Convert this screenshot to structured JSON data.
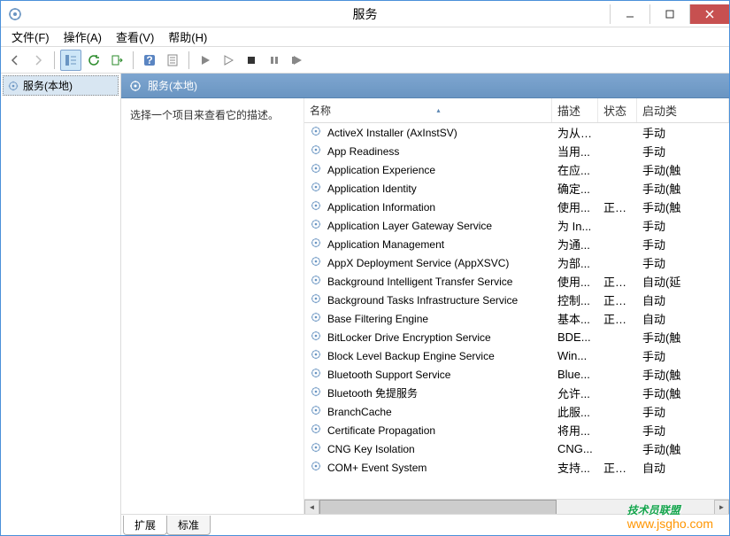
{
  "window": {
    "title": "服务"
  },
  "menu": {
    "file": "文件(F)",
    "action": "操作(A)",
    "view": "查看(V)",
    "help": "帮助(H)"
  },
  "tree": {
    "root": "服务(本地)"
  },
  "content": {
    "header": "服务(本地)",
    "description_prompt": "选择一个项目来查看它的描述。"
  },
  "columns": {
    "name": "名称",
    "desc": "描述",
    "status": "状态",
    "startup": "启动类"
  },
  "tabs": {
    "extended": "扩展",
    "standard": "标准"
  },
  "services": [
    {
      "name": "ActiveX Installer (AxInstSV)",
      "desc": "为从 ...",
      "status": "",
      "startup": "手动"
    },
    {
      "name": "App Readiness",
      "desc": "当用...",
      "status": "",
      "startup": "手动"
    },
    {
      "name": "Application Experience",
      "desc": "在应...",
      "status": "",
      "startup": "手动(触"
    },
    {
      "name": "Application Identity",
      "desc": "确定...",
      "status": "",
      "startup": "手动(触"
    },
    {
      "name": "Application Information",
      "desc": "使用...",
      "status": "正在...",
      "startup": "手动(触"
    },
    {
      "name": "Application Layer Gateway Service",
      "desc": "为 In...",
      "status": "",
      "startup": "手动"
    },
    {
      "name": "Application Management",
      "desc": "为通...",
      "status": "",
      "startup": "手动"
    },
    {
      "name": "AppX Deployment Service (AppXSVC)",
      "desc": "为部...",
      "status": "",
      "startup": "手动"
    },
    {
      "name": "Background Intelligent Transfer Service",
      "desc": "使用...",
      "status": "正在...",
      "startup": "自动(延"
    },
    {
      "name": "Background Tasks Infrastructure Service",
      "desc": "控制...",
      "status": "正在...",
      "startup": "自动"
    },
    {
      "name": "Base Filtering Engine",
      "desc": "基本...",
      "status": "正在...",
      "startup": "自动"
    },
    {
      "name": "BitLocker Drive Encryption Service",
      "desc": "BDE...",
      "status": "",
      "startup": "手动(触"
    },
    {
      "name": "Block Level Backup Engine Service",
      "desc": "Win...",
      "status": "",
      "startup": "手动"
    },
    {
      "name": "Bluetooth Support Service",
      "desc": "Blue...",
      "status": "",
      "startup": "手动(触"
    },
    {
      "name": "Bluetooth 免提服务",
      "desc": "允许...",
      "status": "",
      "startup": "手动(触"
    },
    {
      "name": "BranchCache",
      "desc": "此服...",
      "status": "",
      "startup": "手动"
    },
    {
      "name": "Certificate Propagation",
      "desc": "将用...",
      "status": "",
      "startup": "手动"
    },
    {
      "name": "CNG Key Isolation",
      "desc": "CNG...",
      "status": "",
      "startup": "手动(触"
    },
    {
      "name": "COM+ Event System",
      "desc": "支持...",
      "status": "正在...",
      "startup": "自动"
    }
  ],
  "watermark": {
    "line1": "技术员联盟",
    "line2": "www.jsgho.com"
  }
}
